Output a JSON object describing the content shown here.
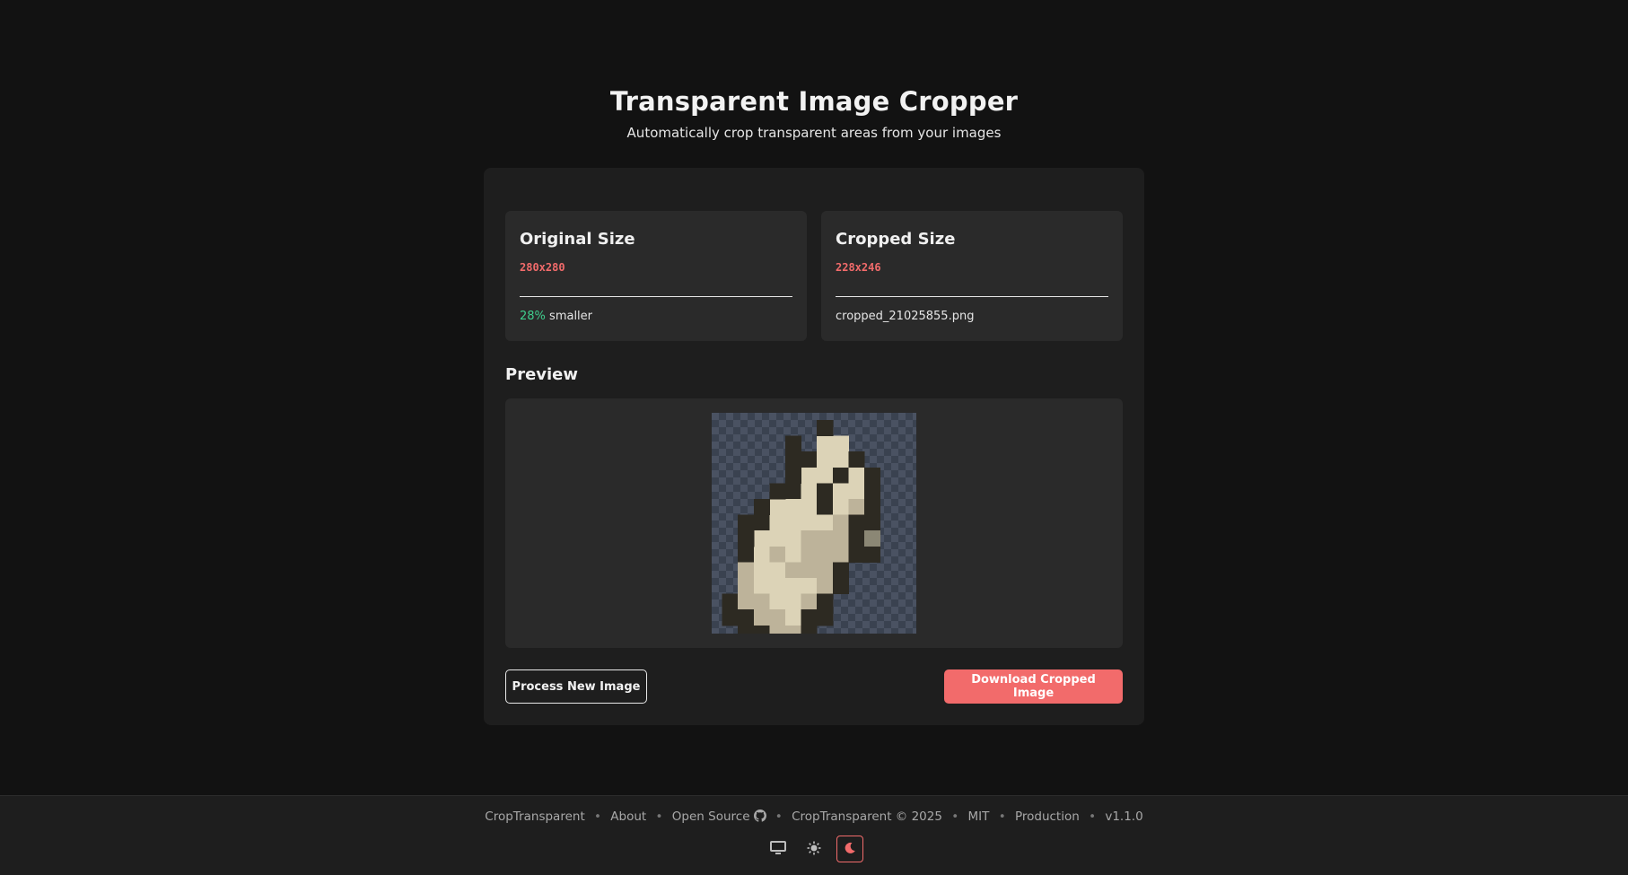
{
  "header": {
    "title": "Transparent Image Cropper",
    "subtitle": "Automatically crop transparent areas from your images"
  },
  "original": {
    "title": "Original Size",
    "dimensions": "280x280",
    "reduction_percent": "28%",
    "reduction_suffix": "smaller"
  },
  "cropped": {
    "title": "Cropped Size",
    "dimensions": "228x246",
    "filename": "cropped_21025855.png"
  },
  "preview": {
    "label": "Preview",
    "image_icon": "pixel-art-cropped-image"
  },
  "actions": {
    "process_label": "Process New Image",
    "download_label": "Download Cropped Image"
  },
  "footer": {
    "brand": "CropTransparent",
    "about": "About",
    "open_source": "Open Source",
    "github_icon": "github-icon",
    "copyright": "CropTransparent © 2025",
    "license": "MIT",
    "environment": "Production",
    "version": "v1.1.0",
    "theme_options": [
      "system",
      "light",
      "dark"
    ],
    "selected_theme": "dark"
  },
  "colors": {
    "background": "#121212",
    "card": "#1e1e1e",
    "panel": "#2a2a2a",
    "accent": "#f26b6b",
    "success": "#3fcf8e"
  }
}
